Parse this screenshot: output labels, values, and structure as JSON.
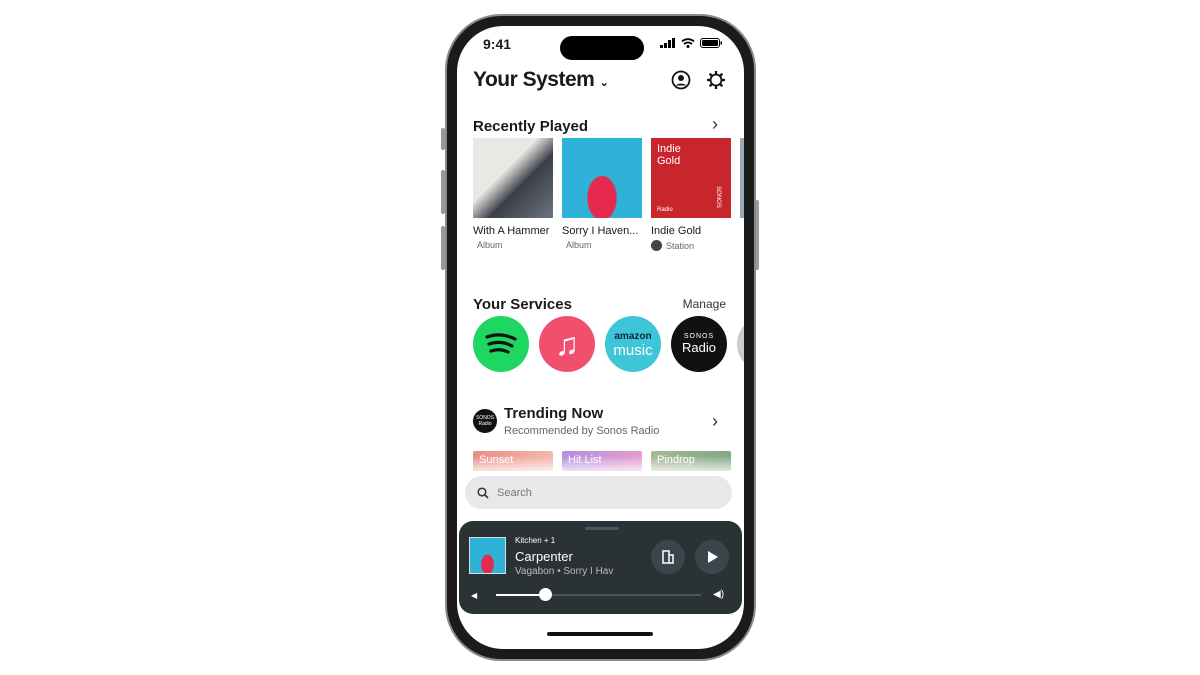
{
  "status": {
    "time": "9:41"
  },
  "header": {
    "title": "Your System"
  },
  "recently_played": {
    "title": "Recently Played",
    "items": [
      {
        "name": "With A Hammer",
        "type": "Album",
        "service": "apple"
      },
      {
        "name": "Sorry I Haven...",
        "type": "Album",
        "service": "apple"
      },
      {
        "name": "Indie Gold",
        "type": "Station",
        "service": "sonos-radio",
        "art_text": "Indie Gold",
        "art_sub": "Radio",
        "art_brand": "SONOS"
      }
    ]
  },
  "services": {
    "title": "Your Services",
    "manage_label": "Manage",
    "items": [
      {
        "name": "Spotify",
        "color": "#1ed760"
      },
      {
        "name": "Apple Music",
        "color": "#f0506e"
      },
      {
        "name": "Amazon Music",
        "color": "#3ec6d8",
        "label1": "amazon",
        "label2": "music"
      },
      {
        "name": "Sonos Radio",
        "color": "#111111",
        "label1": "SONOS",
        "label2": "Radio"
      }
    ]
  },
  "trending": {
    "title": "Trending Now",
    "subtitle": "Recommended by Sonos Radio",
    "badge": "SONOS Radio",
    "items": [
      "Sunset",
      "Hit List",
      "Pindrop"
    ]
  },
  "search": {
    "placeholder": "Search"
  },
  "now_playing": {
    "room": "Kitchen + 1",
    "track": "Carpenter",
    "artist_album": "Vagabon • Sorry I Hav",
    "volume_percent": 24
  }
}
